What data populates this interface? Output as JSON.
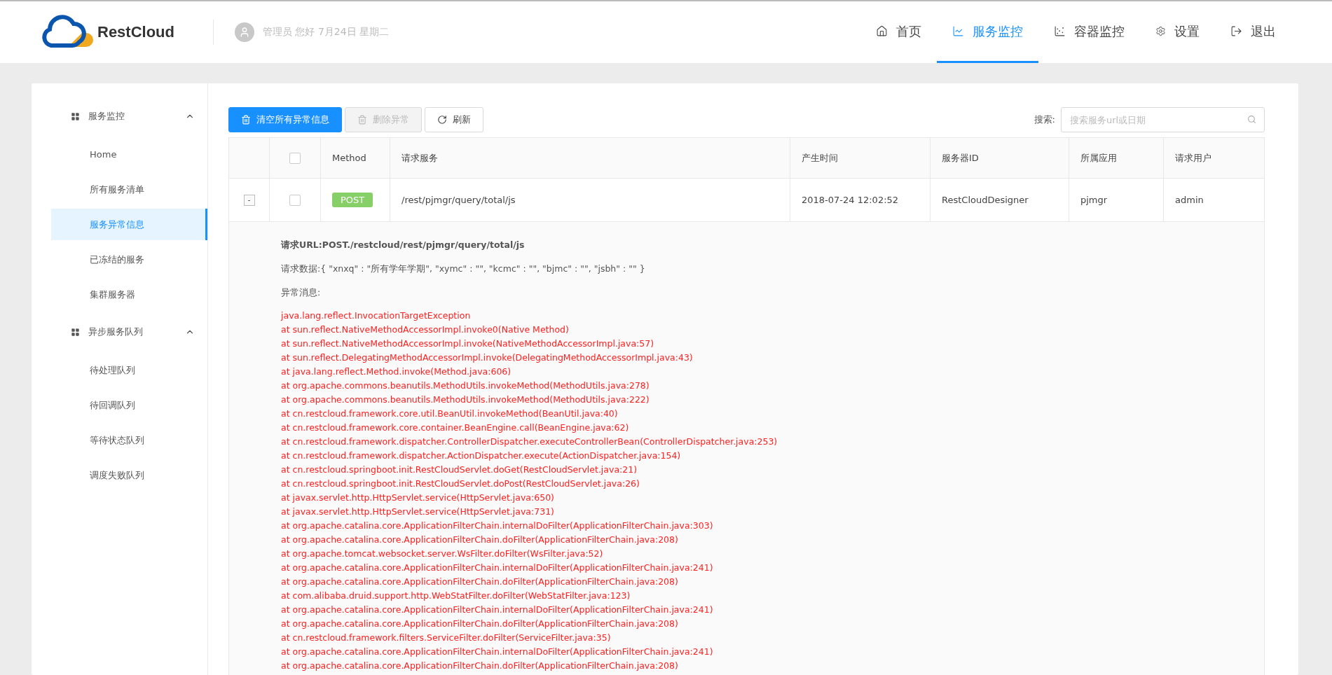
{
  "header": {
    "brand": "RestCloud",
    "greeting": "管理员 您好 7月24日 星期二",
    "nav": [
      {
        "label": "首页",
        "selected": false
      },
      {
        "label": "服务监控",
        "selected": true
      },
      {
        "label": "容器监控",
        "selected": false
      },
      {
        "label": "设置",
        "selected": false
      },
      {
        "label": "退出",
        "selected": false
      }
    ]
  },
  "sidebar": {
    "groups": [
      {
        "label": "服务监控",
        "expanded": true,
        "items": [
          {
            "label": "Home",
            "selected": false
          },
          {
            "label": "所有服务清单",
            "selected": false
          },
          {
            "label": "服务异常信息",
            "selected": true
          },
          {
            "label": "已冻结的服务",
            "selected": false
          },
          {
            "label": "集群服务器",
            "selected": false
          }
        ]
      },
      {
        "label": "异步服务队列",
        "expanded": true,
        "items": [
          {
            "label": "待处理队列",
            "selected": false
          },
          {
            "label": "待回调队列",
            "selected": false
          },
          {
            "label": "等待状态队列",
            "selected": false
          },
          {
            "label": "调度失败队列",
            "selected": false
          }
        ]
      }
    ]
  },
  "toolbar": {
    "buttons": [
      {
        "label": "清空所有异常信息",
        "kind": "primary",
        "disabled": false
      },
      {
        "label": "删除异常",
        "kind": "delete",
        "disabled": true
      },
      {
        "label": "刷新",
        "kind": "refresh",
        "disabled": false
      }
    ],
    "search": {
      "label": "搜索:",
      "placeholder": "搜索服务url或日期"
    }
  },
  "table": {
    "columns": [
      {
        "kind": "expand"
      },
      {
        "kind": "checkbox",
        "checked": false
      },
      {
        "kind": "text",
        "label": "Method"
      },
      {
        "kind": "text",
        "label": "请求服务"
      },
      {
        "kind": "text",
        "label": "产生时间"
      },
      {
        "kind": "text",
        "label": "服务器ID"
      },
      {
        "kind": "text",
        "label": "所属应用"
      },
      {
        "kind": "text",
        "label": "请求用户"
      }
    ],
    "rows": [
      {
        "expanded": true,
        "cells": [
          {
            "kind": "toggle",
            "text": "-"
          },
          {
            "kind": "checkbox",
            "checked": false
          },
          {
            "kind": "badge",
            "text": "POST"
          },
          {
            "kind": "text",
            "text": "/rest/pjmgr/query/total/js"
          },
          {
            "kind": "text",
            "text": "2018-07-24 12:02:52"
          },
          {
            "kind": "text",
            "text": "RestCloudDesigner"
          },
          {
            "kind": "text",
            "text": "pjmgr"
          },
          {
            "kind": "text",
            "text": "admin"
          }
        ],
        "detail": {
          "request_url": "请求URL:POST./restcloud/rest/pjmgr/query/total/js",
          "request_data": "请求数据:{ \"xnxq\" : \"所有学年学期\", \"xymc\" : \"\", \"kcmc\" : \"\", \"bjmc\" : \"\", \"jsbh\" : \"\" }",
          "message_label": "异常消息:",
          "stack_trace": [
            "java.lang.reflect.InvocationTargetException",
            "at sun.reflect.NativeMethodAccessorImpl.invoke0(Native Method)",
            "at sun.reflect.NativeMethodAccessorImpl.invoke(NativeMethodAccessorImpl.java:57)",
            "at sun.reflect.DelegatingMethodAccessorImpl.invoke(DelegatingMethodAccessorImpl.java:43)",
            "at java.lang.reflect.Method.invoke(Method.java:606)",
            "at org.apache.commons.beanutils.MethodUtils.invokeMethod(MethodUtils.java:278)",
            "at org.apache.commons.beanutils.MethodUtils.invokeMethod(MethodUtils.java:222)",
            "at cn.restcloud.framework.core.util.BeanUtil.invokeMethod(BeanUtil.java:40)",
            "at cn.restcloud.framework.core.container.BeanEngine.call(BeanEngine.java:62)",
            "at cn.restcloud.framework.dispatcher.ControllerDispatcher.executeControllerBean(ControllerDispatcher.java:253)",
            "at cn.restcloud.framework.dispatcher.ActionDispatcher.execute(ActionDispatcher.java:154)",
            "at cn.restcloud.springboot.init.RestCloudServlet.doGet(RestCloudServlet.java:21)",
            "at cn.restcloud.springboot.init.RestCloudServlet.doPost(RestCloudServlet.java:26)",
            "at javax.servlet.http.HttpServlet.service(HttpServlet.java:650)",
            "at javax.servlet.http.HttpServlet.service(HttpServlet.java:731)",
            "at org.apache.catalina.core.ApplicationFilterChain.internalDoFilter(ApplicationFilterChain.java:303)",
            "at org.apache.catalina.core.ApplicationFilterChain.doFilter(ApplicationFilterChain.java:208)",
            "at org.apache.tomcat.websocket.server.WsFilter.doFilter(WsFilter.java:52)",
            "at org.apache.catalina.core.ApplicationFilterChain.internalDoFilter(ApplicationFilterChain.java:241)",
            "at org.apache.catalina.core.ApplicationFilterChain.doFilter(ApplicationFilterChain.java:208)",
            "at com.alibaba.druid.support.http.WebStatFilter.doFilter(WebStatFilter.java:123)",
            "at org.apache.catalina.core.ApplicationFilterChain.internalDoFilter(ApplicationFilterChain.java:241)",
            "at org.apache.catalina.core.ApplicationFilterChain.doFilter(ApplicationFilterChain.java:208)",
            "at cn.restcloud.framework.filters.ServiceFilter.doFilter(ServiceFilter.java:35)",
            "at org.apache.catalina.core.ApplicationFilterChain.internalDoFilter(ApplicationFilterChain.java:241)",
            "at org.apache.catalina.core.ApplicationFilterChain.doFilter(ApplicationFilterChain.java:208)"
          ]
        }
      }
    ]
  }
}
